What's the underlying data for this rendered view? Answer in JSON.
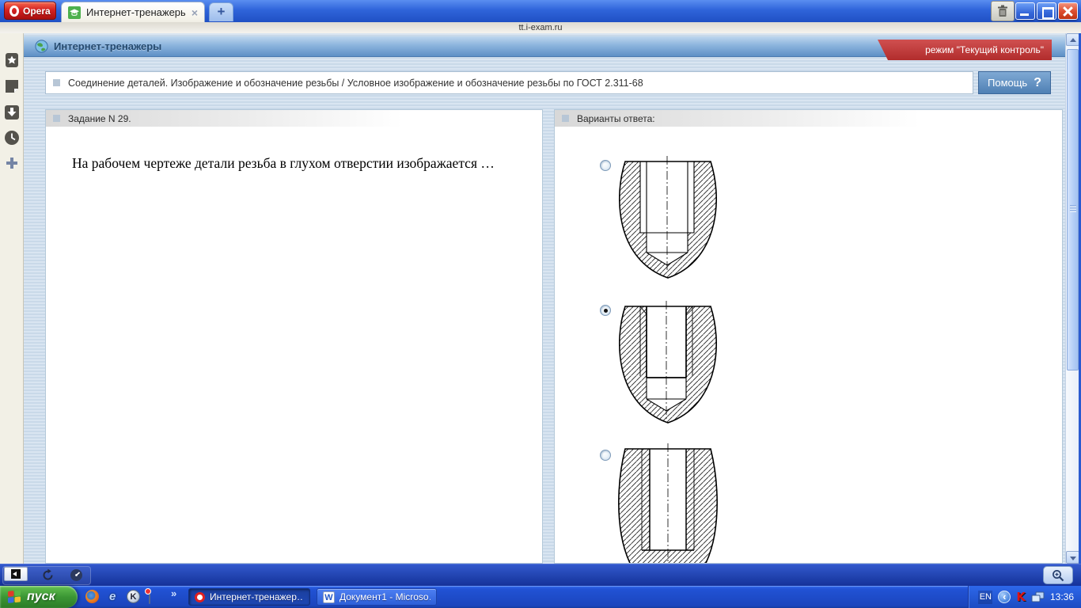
{
  "browser": {
    "menu_label": "Opera",
    "tab_title": "Интернет-тренажеры",
    "tab_close_glyph": "×",
    "new_tab_glyph": "+",
    "url": "tt.i-exam.ru"
  },
  "site": {
    "header_title": "Интернет-тренажеры",
    "mode_badge": "режим \"Текущий контроль\"",
    "breadcrumb": "Соединение деталей. Изображение и обозначение резьбы / Условное изображение и обозначение резьбы по ГОСТ 2.311-68",
    "help_label": "Помощь",
    "help_glyph": "?"
  },
  "question": {
    "panel_title": "Задание N 29.",
    "text": "На рабочем чертеже детали резьба в глухом отверстии изображается …"
  },
  "answers": {
    "panel_title": "Варианты ответа:",
    "options": [
      {
        "id": 1,
        "selected": false,
        "image": "blind-threaded-hole-drawing-variant-1"
      },
      {
        "id": 2,
        "selected": true,
        "image": "blind-threaded-hole-drawing-variant-2"
      },
      {
        "id": 3,
        "selected": false,
        "image": "blind-threaded-hole-drawing-variant-3"
      }
    ]
  },
  "icons": {
    "ie_glyph": "e",
    "kmeleon_glyph": "K"
  },
  "taskbar": {
    "start_label": "пуск",
    "overflow_glyph": "»",
    "tasks": [
      {
        "label": "Интернет-тренажер…",
        "active": true,
        "icon": "opera"
      },
      {
        "label": "Документ1 - Microso…",
        "active": false,
        "icon": "word",
        "icon_letter": "W"
      }
    ],
    "tray": {
      "language": "EN",
      "collapse_glyph": "‹",
      "kaspersky_glyph": "K",
      "time": "13:36"
    }
  },
  "colors": {
    "browser_chrome_blue": "#2f64da",
    "opera_red": "#c01818",
    "site_header_blue": "#6f9fd0",
    "mode_ribbon_red": "#b12c2c",
    "page_stripe_blue": "#c9d9e9",
    "help_button_blue": "#4f80b4",
    "taskbar_blue": "#2152d4",
    "start_green": "#3b9634",
    "radio_dot": "#141414"
  }
}
